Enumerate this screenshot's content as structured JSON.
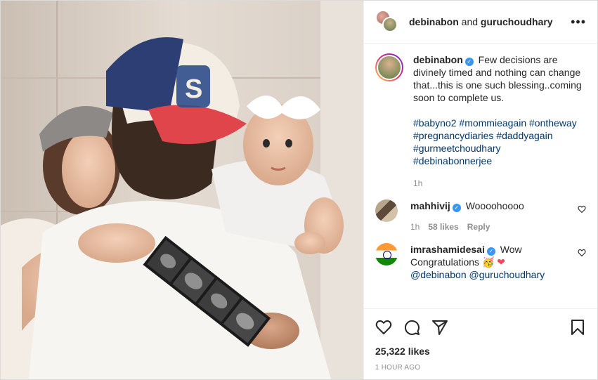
{
  "header": {
    "user1": "debinabon",
    "and_text": "and",
    "user2": "guruchoudhary",
    "more_icon": "more-horizontal-icon"
  },
  "caption": {
    "username": "debinabon",
    "text": "Few decisions are divinely timed and nothing can change that...this is one such blessing..coming soon to complete us.",
    "hashtags": [
      "#babyno2",
      "#mommieagain",
      "#ontheway",
      "#pregnancydiaries",
      "#daddyagain",
      "#gurmeetchoudhary",
      "#debinabonnerjee"
    ],
    "time": "1h"
  },
  "comments": [
    {
      "username": "mahhivij",
      "text": "Woooohoooo",
      "time": "1h",
      "likes": "58 likes",
      "reply": "Reply"
    },
    {
      "username": "imrashamidesai",
      "text": "Wow",
      "text2": "Congratulations",
      "emoji1": "🥳",
      "emoji2": "❤",
      "mention1": "@debinabon",
      "mention2": "@guruchoudhary"
    }
  ],
  "actions": {
    "likes": "25,322 likes",
    "posted": "1 HOUR AGO"
  },
  "colors": {
    "link": "#00376b",
    "verified": "#3897f0",
    "muted": "#8e8e8e",
    "heart": "#ed4956"
  }
}
